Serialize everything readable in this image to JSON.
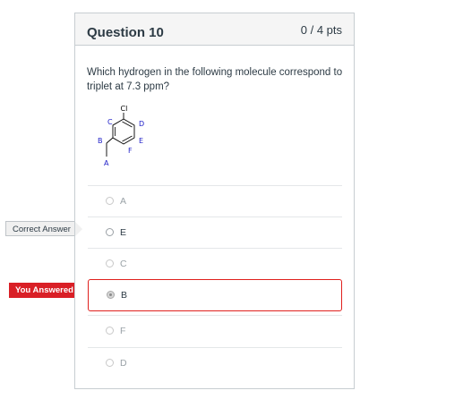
{
  "question": {
    "title": "Question 10",
    "points": "0 / 4 pts",
    "text": "Which hydrogen in the following molecule correspond to triplet at 7.3 ppm?"
  },
  "molecule": {
    "substituent": "Cl",
    "labels": [
      "A",
      "B",
      "C",
      "D",
      "E",
      "F"
    ]
  },
  "answers": [
    {
      "label": "A"
    },
    {
      "label": "E"
    },
    {
      "label": "C"
    },
    {
      "label": "B"
    },
    {
      "label": "F"
    },
    {
      "label": "D"
    }
  ],
  "flags": {
    "correct": "Correct Answer",
    "you_answered": "You Answered"
  },
  "colors": {
    "wrong": "#d91f26",
    "correct_flag_bg": "#f0f0f0",
    "header_bg": "#f5f5f5",
    "molecule_label": "#2020c8"
  }
}
